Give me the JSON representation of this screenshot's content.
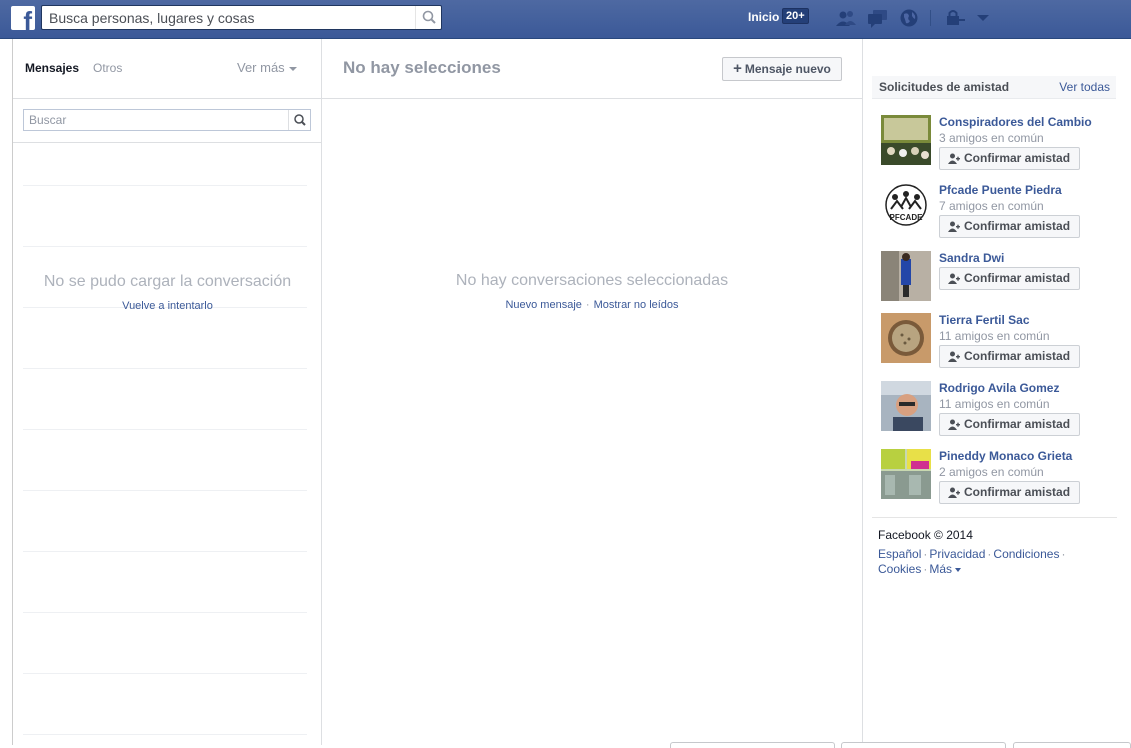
{
  "topbar": {
    "logo_letter": "f",
    "search_placeholder": "Busca personas, lugares y cosas",
    "home_label": "Inicio",
    "home_badge": "20+",
    "icons": [
      "friend-requests-icon",
      "messages-icon",
      "notifications-globe-icon",
      "privacy-lock-icon",
      "account-menu-icon"
    ]
  },
  "messages": {
    "tab_messages": "Mensajes",
    "tab_other": "Otros",
    "see_more": "Ver más",
    "search_placeholder": "Buscar",
    "error_title": "No se pudo cargar la conversación",
    "retry_link": "Vuelve a intentarlo"
  },
  "conversation": {
    "title": "No hay selecciones",
    "new_message_label": "Mensaje nuevo",
    "empty_text": "No hay conversaciones seleccionadas",
    "link_new": "Nuevo mensaje",
    "separator": "·",
    "link_unread": "Mostrar no leídos"
  },
  "friend_requests": {
    "title": "Solicitudes de amistad",
    "see_all": "Ver todas",
    "confirm_label": "Confirmar amistad",
    "items": [
      {
        "name": "Conspiradores del Cambio",
        "mutual": "3 amigos en común"
      },
      {
        "name": "Pfcade Puente Piedra",
        "mutual": "7 amigos en común"
      },
      {
        "name": "Sandra Dwi",
        "mutual": ""
      },
      {
        "name": "Tierra Fertil Sac",
        "mutual": "11 amigos en común"
      },
      {
        "name": "Rodrigo Avila Gomez",
        "mutual": "11 amigos en común"
      },
      {
        "name": "Pineddy Monaco Grieta",
        "mutual": "2 amigos en común"
      }
    ]
  },
  "footer": {
    "copyright": "Facebook © 2014",
    "links": [
      "Español",
      "Privacidad",
      "Condiciones",
      "Cookies",
      "Más"
    ],
    "separator": "·"
  },
  "colors": {
    "brand": "#3b5998",
    "topbar": "#4e69a2",
    "muted_text": "#9197a3",
    "link": "#3b5998"
  }
}
